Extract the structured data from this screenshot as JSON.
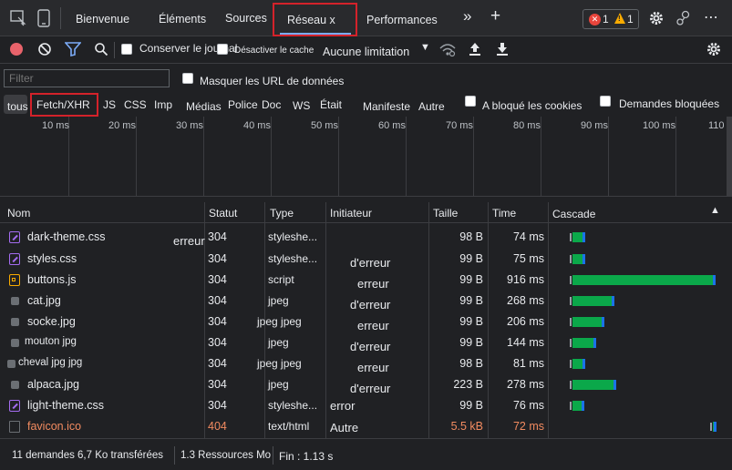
{
  "tabs": {
    "welcome": "Bienvenue",
    "elements": "Éléments",
    "sources": "Sources",
    "network": "Réseau x",
    "performance": "Performances",
    "more": "»",
    "add": "+",
    "errors": "1",
    "warnings": "1",
    "menu": "⋯"
  },
  "toolbar": {
    "preserve_log": "Conserver le journal",
    "disable_cache": "Désactiver le cache",
    "throttling": "Aucune limitation"
  },
  "filter": {
    "placeholder": "Filter",
    "hide_data_urls": "Masquer les URL de données",
    "types": [
      "tous",
      "Fetch/XHR",
      "JS",
      "CSS",
      "Imp",
      "Médias",
      "Police",
      "Doc",
      "WS",
      "Était",
      "Manifeste",
      "Autre"
    ],
    "blocked_cookies": "A bloqué les cookies",
    "blocked_requests": "Demandes bloquées"
  },
  "overview": {
    "ticks": [
      "10 ms",
      "20 ms",
      "30 ms",
      "40 ms",
      "50 ms",
      "60 ms",
      "70 ms",
      "80 ms",
      "90 ms",
      "100 ms",
      "110"
    ]
  },
  "table": {
    "headers": {
      "name": "Nom",
      "status": "Statut",
      "type": "Type",
      "initiator": "Initiateur",
      "size": "Taille",
      "time": "Time",
      "waterfall": "Cascade",
      "sort": "▲"
    },
    "rows": [
      {
        "name": "dark-theme.css",
        "icon": "css-file-icon",
        "status": "304",
        "type": "styleshe...",
        "initiator": "erreur",
        "size": "98 B",
        "time": "74 ms",
        "bar_start": 0.0,
        "bar_len": 0.09,
        "error": false
      },
      {
        "name": "styles.css",
        "icon": "css-file-icon",
        "status": "304",
        "type": "styleshe...",
        "initiator": "d'erreur",
        "size": "99 B",
        "time": "75 ms",
        "bar_start": 0.0,
        "bar_len": 0.09,
        "error": false
      },
      {
        "name": "buttons.js",
        "icon": "js-file-icon",
        "status": "304",
        "type": "script",
        "initiator": "erreur",
        "size": "99 B",
        "time": "916 ms",
        "bar_start": 0.0,
        "bar_len": 0.98,
        "error": false
      },
      {
        "name": "cat.jpg",
        "icon": "image-file-icon",
        "status": "304",
        "type": "jpeg",
        "initiator": "d'erreur",
        "size": "99 B",
        "time": "268 ms",
        "bar_start": 0.0,
        "bar_len": 0.29,
        "error": false
      },
      {
        "name": "socke.jpg",
        "icon": "image-file-icon",
        "status": "304",
        "type": "jpeg jpeg",
        "initiator": "erreur",
        "size": "99 B",
        "time": "206 ms",
        "bar_start": 0.0,
        "bar_len": 0.22,
        "error": false
      },
      {
        "name": "mouton jpg",
        "icon": "image-file-icon",
        "status": "304",
        "type": "jpeg",
        "initiator": "d'erreur",
        "size": "99 B",
        "time": "144 ms",
        "bar_start": 0.0,
        "bar_len": 0.16,
        "error": false
      },
      {
        "name": "cheval jpg jpg",
        "icon": "image-file-icon",
        "status": "304",
        "type": "jpeg jpeg",
        "initiator": "erreur",
        "size": "98 B",
        "time": "81 ms",
        "bar_start": 0.0,
        "bar_len": 0.09,
        "error": false
      },
      {
        "name": "alpaca.jpg",
        "icon": "image-file-icon",
        "status": "304",
        "type": "jpeg",
        "initiator": "d'erreur",
        "size": "223 B",
        "time": "278 ms",
        "bar_start": 0.0,
        "bar_len": 0.3,
        "error": false
      },
      {
        "name": "light-theme.css",
        "icon": "css-file-icon",
        "status": "304",
        "type": "styleshe...",
        "initiator": "error",
        "size": "99 B",
        "time": "76 ms",
        "bar_start": 0.0,
        "bar_len": 0.08,
        "error": false
      },
      {
        "name": "favicon.ico",
        "icon": "generic-file-icon",
        "status": "404",
        "type": "text/html",
        "initiator": "Autre",
        "size": "5.5 kB",
        "time": "72 ms",
        "bar_start": 0.96,
        "bar_len": 0.02,
        "error": true
      }
    ]
  },
  "status": {
    "requests": "11 demandes 6,7 Ko transférées",
    "resources": "1.3 Ressources Mo",
    "finish": "Fin : 1.13 s"
  },
  "colors": {
    "error_text": "#f28b60",
    "css_icon": "#a46cf0",
    "js_icon": "#f9ab00",
    "bar_green": "#0ba84a",
    "bar_blue": "#1a73e8",
    "highlight_red": "#d4222a"
  }
}
